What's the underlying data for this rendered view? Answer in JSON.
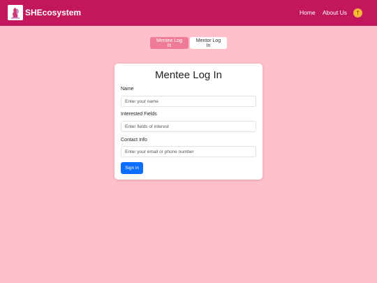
{
  "navbar": {
    "brand": "SHEcosystem",
    "links": [
      "Home",
      "About Us"
    ],
    "logo_icon": "woman-silhouette-logo-icon",
    "profile_icon": "profile-badge-icon"
  },
  "toggle": {
    "mentee_label": "Mentee Log In",
    "mentor_label": "Mentor Log In",
    "active": "mentee"
  },
  "form": {
    "title": "Mentee Log In",
    "fields": [
      {
        "label": "Name",
        "placeholder": "Enter your name",
        "value": ""
      },
      {
        "label": "Interested Fields",
        "placeholder": "Enter fields of interest",
        "value": ""
      },
      {
        "label": "Contact Info",
        "placeholder": "Enter your email or phone number",
        "value": ""
      }
    ],
    "submit_label": "Sign in"
  },
  "colors": {
    "page_background": "#ffc0cb",
    "navbar": "#c2185b",
    "active_toggle": "#ee7c98",
    "primary_button": "#0d6efd"
  }
}
